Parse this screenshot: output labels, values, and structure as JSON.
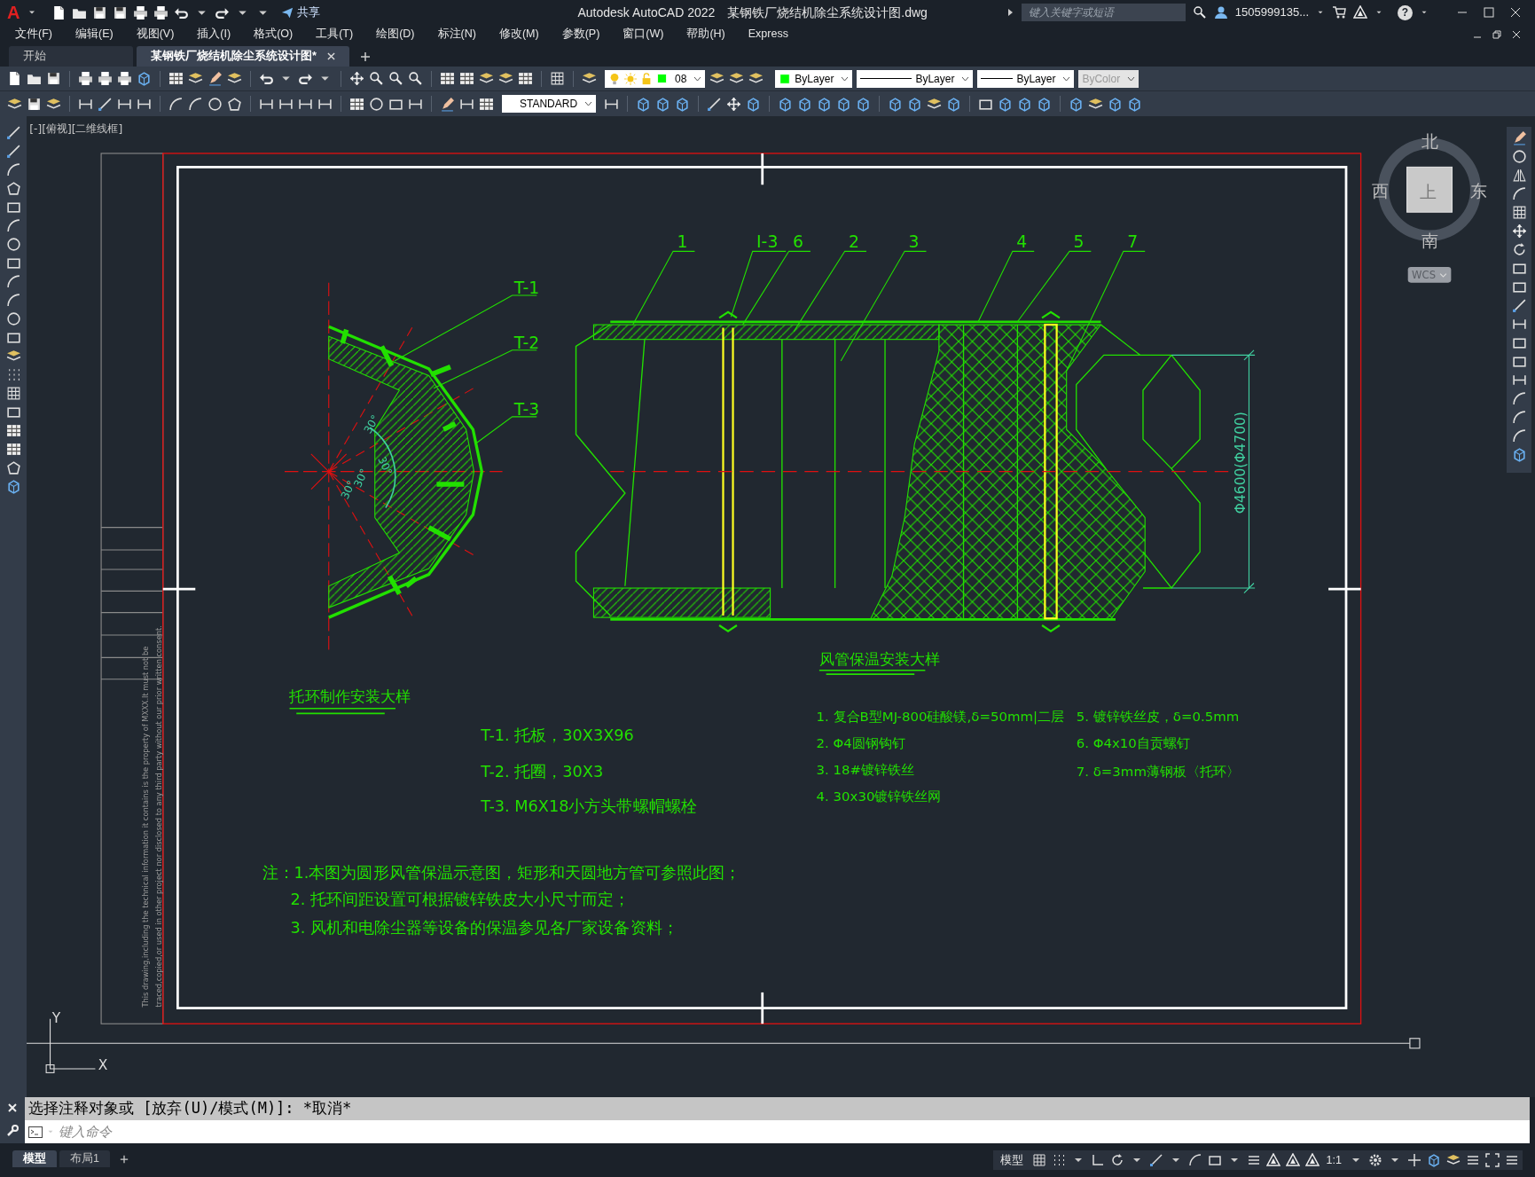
{
  "title_bar": {
    "logo": "A",
    "share": "共享",
    "app_title": "Autodesk AutoCAD 2022",
    "file_name": "某钢铁厂烧结机除尘系统设计图.dwg",
    "search": {
      "placeholder": "键入关键字或短语"
    },
    "user": "1505999135...",
    "help": "?"
  },
  "menu": [
    "文件(F)",
    "编辑(E)",
    "视图(V)",
    "插入(I)",
    "格式(O)",
    "工具(T)",
    "绘图(D)",
    "标注(N)",
    "修改(M)",
    "参数(P)",
    "窗口(W)",
    "帮助(H)",
    "Express"
  ],
  "doc_tabs": [
    {
      "label": "开始",
      "selected": false
    },
    {
      "label": "某钢铁厂烧结机除尘系统设计图*",
      "selected": true
    }
  ],
  "toolbar": {
    "layer": "08",
    "color_control": "ByLayer",
    "linetype": "ByLayer",
    "lineweight": "ByLayer",
    "plot_style": {
      "value": "ByColor",
      "disabled": true
    },
    "text_style": "STANDARD"
  },
  "viewport_label": "[-][俯视][二维线框]",
  "viewcube": {
    "north": "北",
    "south": "南",
    "west": "西",
    "east": "东",
    "face": "上",
    "ucs": "WCS"
  },
  "drawing": {
    "title_block": {
      "disclaimer": [
        "This drawing,including the technical information it contains is the property of MXXX.It must not be",
        "traced,copied,or used in other project nor disclosed to any third party without our prior written consent."
      ]
    },
    "ring_detail": {
      "leader_labels": [
        "T-1",
        "T-2",
        "T-3"
      ],
      "angle_labels": [
        "30°",
        "30°",
        "30°",
        "30°"
      ],
      "title": "托环制作安装大样",
      "parts": [
        "T-1. 托板，30X3X96",
        "T-2. 托圈，30X3",
        "T-3. M6X18小方头带螺帽螺栓"
      ]
    },
    "duct_detail": {
      "leader_labels": [
        "1",
        "I-3",
        "6",
        "2",
        "3",
        "4",
        "5",
        "7"
      ],
      "dimension": "Φ4600(Φ4700)",
      "title": "风管保温安装大样",
      "legend": [
        "1. 复合B型MJ-800硅酸镁,δ=50mm|二层",
        "2. Φ4圆钢钩钉",
        "3. 18#镀锌铁丝",
        "4. 30x30镀锌铁丝网",
        "5. 镀锌铁丝皮，δ=0.5mm",
        "6. Φ4x10自贡螺钉",
        "7. δ=3mm薄钢板〈托环〉"
      ]
    },
    "notes": [
      "注：1.本图为圆形风管保温示意图，矩形和天圆地方管可参照此图；",
      "2. 托环间距设置可根据镀锌铁皮大小尺寸而定；",
      "3. 风机和电除尘器等设备的保温参见各厂家设备资料；"
    ],
    "ucs": {
      "y": "Y",
      "x": "X"
    }
  },
  "command": {
    "history": "选择注释对象或 [放弃(U)/模式(M)]: *取消*",
    "placeholder": "键入命令"
  },
  "layout_tabs": [
    {
      "label": "模型",
      "selected": true
    },
    {
      "label": "布局1",
      "selected": false
    }
  ],
  "status_bar": {
    "space": "模型",
    "scale": "1:1"
  }
}
